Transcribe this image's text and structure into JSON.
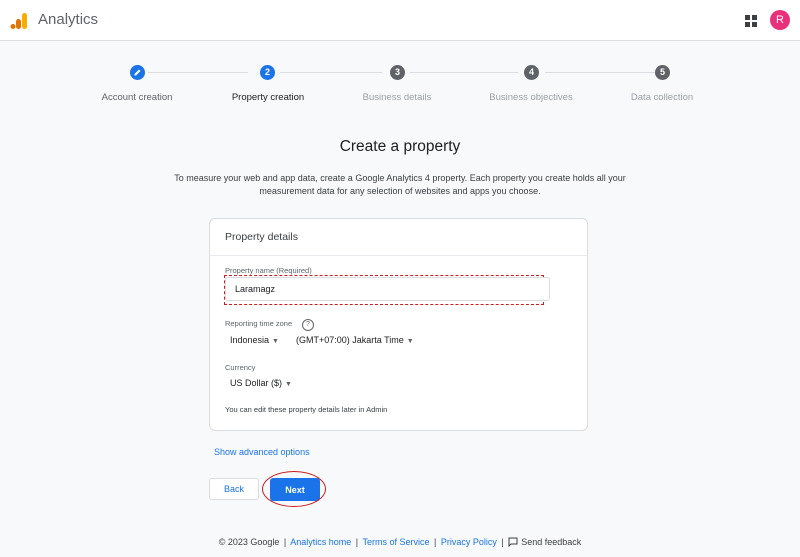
{
  "header": {
    "app_title": "Analytics",
    "avatar_letter": "R",
    "colors": {
      "brand_orange": "#f9ab00",
      "brand_dark": "#e37400",
      "avatar": "#e8317a"
    }
  },
  "stepper": {
    "steps": [
      {
        "label": "Account creation",
        "badge": "",
        "icon": "pencil-icon",
        "state": "completed"
      },
      {
        "label": "Property creation",
        "badge": "2",
        "state": "current"
      },
      {
        "label": "Business details",
        "badge": "3",
        "state": "upcoming"
      },
      {
        "label": "Business objectives",
        "badge": "4",
        "state": "upcoming"
      },
      {
        "label": "Data collection",
        "badge": "5",
        "state": "upcoming"
      }
    ]
  },
  "page": {
    "title": "Create a property",
    "description_line1": "To measure your web and app data, create a Google Analytics 4 property. Each property you create holds all your",
    "description_line2": "measurement data for any selection of websites and apps you choose."
  },
  "card": {
    "title": "Property details",
    "property_name_label": "Property name (Required)",
    "property_name_value": "Laramagz",
    "timezone_label": "Reporting time zone",
    "timezone_country": "Indonesia",
    "timezone_value": "(GMT+07:00) Jakarta Time",
    "currency_label": "Currency",
    "currency_value": "US Dollar ($)",
    "note": "You can edit these property details later in Admin"
  },
  "actions": {
    "advanced_label": "Show advanced options",
    "back_label": "Back",
    "next_label": "Next"
  },
  "footer": {
    "copyright": "© 2023 Google",
    "analytics_home": "Analytics home",
    "terms": "Terms of Service",
    "privacy": "Privacy Policy",
    "feedback": "Send feedback"
  },
  "colors": {
    "primary": "#1a73e8",
    "annotation_red": "#cc1c1c"
  }
}
